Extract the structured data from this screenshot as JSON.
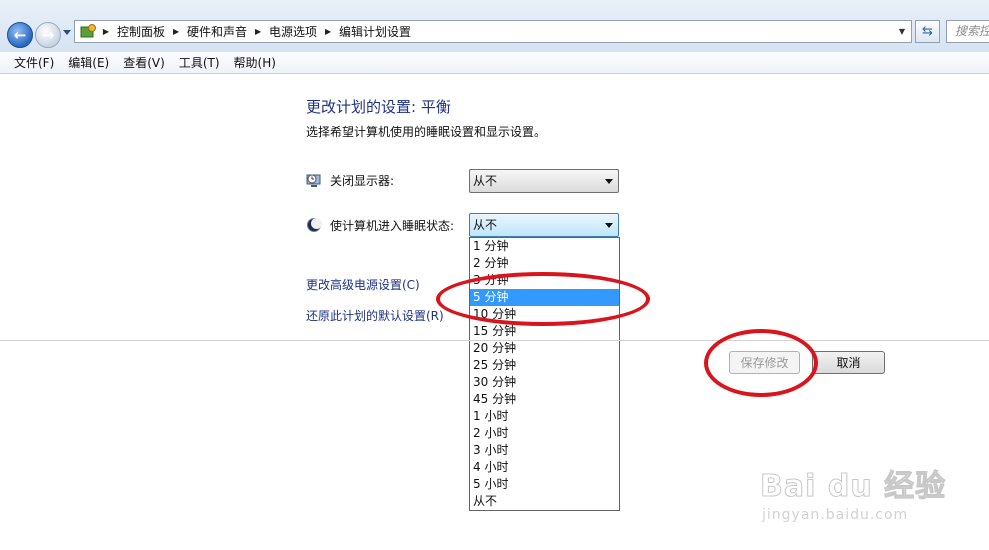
{
  "nav": {
    "back_icon": "back-arrow-icon",
    "forward_icon": "forward-arrow-icon",
    "back_glyph": "←",
    "forward_glyph": "→"
  },
  "address": {
    "icon": "control-panel-icon",
    "breadcrumbs": [
      "控制面板",
      "硬件和声音",
      "电源选项",
      "编辑计划设置"
    ],
    "search_placeholder": "搜索控"
  },
  "menu": [
    "文件(F)",
    "编辑(E)",
    "查看(V)",
    "工具(T)",
    "帮助(H)"
  ],
  "page": {
    "title": "更改计划的设置: 平衡",
    "subtitle": "选择希望计算机使用的睡眠设置和显示设置。"
  },
  "settings": {
    "display": {
      "label": "关闭显示器:",
      "value": "从不",
      "icon": "monitor-clock-icon"
    },
    "sleep": {
      "label": "使计算机进入睡眠状态:",
      "value": "从不",
      "icon": "moon-icon"
    }
  },
  "sleep_options": [
    "1 分钟",
    "2 分钟",
    "3 分钟",
    "5 分钟",
    "10 分钟",
    "15 分钟",
    "20 分钟",
    "25 分钟",
    "30 分钟",
    "45 分钟",
    "1 小时",
    "2 小时",
    "3 小时",
    "4 小时",
    "5 小时",
    "从不"
  ],
  "sleep_highlighted": "5 分钟",
  "links": {
    "advanced": "更改高级电源设置(C)",
    "restore": "还原此计划的默认设置(R)"
  },
  "buttons": {
    "save": "保存修改",
    "cancel": "取消"
  },
  "watermark": {
    "main": "Bai du 经验",
    "sub": "jingyan.baidu.com"
  },
  "colors": {
    "accent_link": "#1e3287",
    "highlight": "#3399ff",
    "annotation_circle": "#d9141c"
  }
}
